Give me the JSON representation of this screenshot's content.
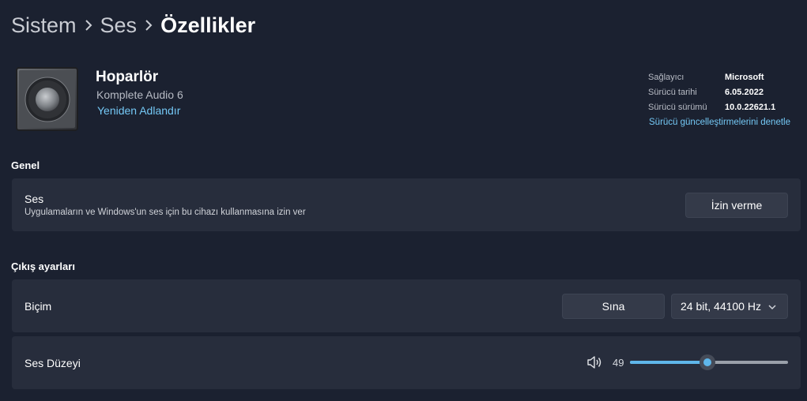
{
  "breadcrumb": {
    "items": [
      "Sistem",
      "Ses",
      "Özellikler"
    ]
  },
  "device": {
    "name": "Hoparlör",
    "model": "Komplete Audio 6",
    "rename_label": "Yeniden Adlandır",
    "icon": "speaker-icon"
  },
  "driver_info": {
    "provider_label": "Sağlayıcı",
    "provider_value": "Microsoft",
    "date_label": "Sürücü tarihi",
    "date_value": "6.05.2022",
    "version_label": "Sürücü sürümü",
    "version_value": "10.0.22621.1",
    "update_link": "Sürücü güncelleştirmelerini denetle"
  },
  "general": {
    "title": "Genel",
    "audio_card": {
      "title": "Ses",
      "description": "Uygulamaların ve Windows'un ses için bu cihazı kullanmasına izin ver",
      "button_label": "İzin verme"
    }
  },
  "output": {
    "title": "Çıkış ayarları",
    "format": {
      "label": "Biçim",
      "test_button": "Sına",
      "selected": "24 bit, 44100 Hz"
    },
    "volume": {
      "label": "Ses Düzeyi",
      "value": "49",
      "level": 0.49
    }
  },
  "colors": {
    "accent": "#5fb6ea",
    "link": "#74c8f5",
    "background": "#1b2130",
    "card": "#272d3c"
  }
}
